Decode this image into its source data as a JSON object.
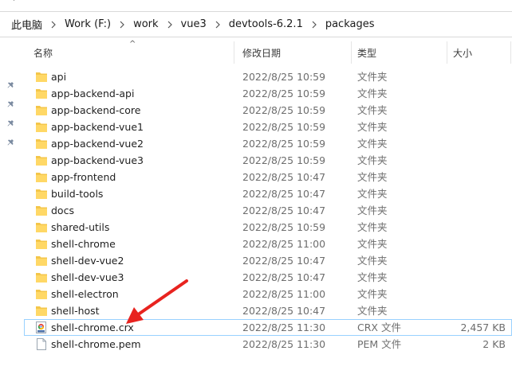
{
  "breadcrumb": {
    "items": [
      "此电脑",
      "Work (F:)",
      "work",
      "vue3",
      "devtools-6.2.1",
      "packages"
    ]
  },
  "columns": {
    "name": "名称",
    "date": "修改日期",
    "type": "类型",
    "size": "大小"
  },
  "files": [
    {
      "name": "api",
      "date": "2022/8/25 10:59",
      "type": "文件夹",
      "size": "",
      "icon": "folder-icon"
    },
    {
      "name": "app-backend-api",
      "date": "2022/8/25 10:59",
      "type": "文件夹",
      "size": "",
      "icon": "folder-icon"
    },
    {
      "name": "app-backend-core",
      "date": "2022/8/25 10:59",
      "type": "文件夹",
      "size": "",
      "icon": "folder-icon"
    },
    {
      "name": "app-backend-vue1",
      "date": "2022/8/25 10:59",
      "type": "文件夹",
      "size": "",
      "icon": "folder-icon"
    },
    {
      "name": "app-backend-vue2",
      "date": "2022/8/25 10:59",
      "type": "文件夹",
      "size": "",
      "icon": "folder-icon"
    },
    {
      "name": "app-backend-vue3",
      "date": "2022/8/25 10:59",
      "type": "文件夹",
      "size": "",
      "icon": "folder-icon"
    },
    {
      "name": "app-frontend",
      "date": "2022/8/25 10:47",
      "type": "文件夹",
      "size": "",
      "icon": "folder-icon"
    },
    {
      "name": "build-tools",
      "date": "2022/8/25 10:47",
      "type": "文件夹",
      "size": "",
      "icon": "folder-icon"
    },
    {
      "name": "docs",
      "date": "2022/8/25 10:47",
      "type": "文件夹",
      "size": "",
      "icon": "folder-icon"
    },
    {
      "name": "shared-utils",
      "date": "2022/8/25 10:59",
      "type": "文件夹",
      "size": "",
      "icon": "folder-icon"
    },
    {
      "name": "shell-chrome",
      "date": "2022/8/25 11:00",
      "type": "文件夹",
      "size": "",
      "icon": "folder-icon"
    },
    {
      "name": "shell-dev-vue2",
      "date": "2022/8/25 10:47",
      "type": "文件夹",
      "size": "",
      "icon": "folder-icon"
    },
    {
      "name": "shell-dev-vue3",
      "date": "2022/8/25 10:47",
      "type": "文件夹",
      "size": "",
      "icon": "folder-icon"
    },
    {
      "name": "shell-electron",
      "date": "2022/8/25 11:00",
      "type": "文件夹",
      "size": "",
      "icon": "folder-icon"
    },
    {
      "name": "shell-host",
      "date": "2022/8/25 10:47",
      "type": "文件夹",
      "size": "",
      "icon": "folder-icon"
    },
    {
      "name": "shell-chrome.crx",
      "date": "2022/8/25 11:30",
      "type": "CRX 文件",
      "size": "2,457 KB",
      "icon": "crx-file-icon",
      "selected": true
    },
    {
      "name": "shell-chrome.pem",
      "date": "2022/8/25 11:30",
      "type": "PEM 文件",
      "size": "2 KB",
      "icon": "document-file-icon"
    }
  ],
  "colors": {
    "folder": "#f4c64a",
    "selection_border": "#99d1ff",
    "annotation_arrow": "#e8231f"
  }
}
